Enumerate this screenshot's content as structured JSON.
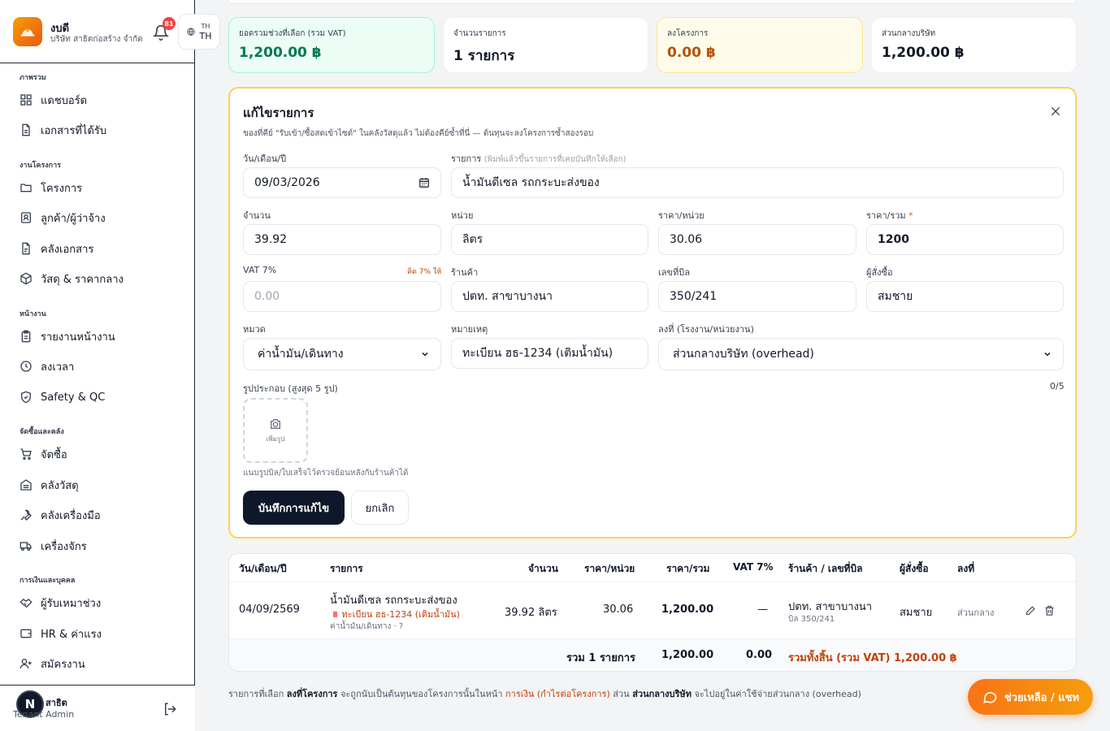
{
  "brand": {
    "title": "งบดี",
    "subtitle": "บริษัท สาธิตก่อสร้าง จำกัด",
    "notification_count": "81"
  },
  "lang": {
    "small": "TH",
    "big": "TH"
  },
  "nav": {
    "sections": [
      {
        "title": "ภาพรวม",
        "items": [
          "แดชบอร์ด",
          "เอกสารที่ได้รับ"
        ]
      },
      {
        "title": "งานโครงการ",
        "items": [
          "โครงการ",
          "ลูกค้า/ผู้ว่าจ้าง",
          "คลังเอกสาร",
          "วัสดุ & ราคากลาง"
        ]
      },
      {
        "title": "หน้างาน",
        "items": [
          "รายงานหน้างาน",
          "ลงเวลา",
          "Safety & QC"
        ]
      },
      {
        "title": "จัดซื้อและคลัง",
        "items": [
          "จัดซื้อ",
          "คลังวัสดุ",
          "คลังเครื่องมือ",
          "เครื่องจักร"
        ]
      },
      {
        "title": "การเงินและบุคคล",
        "items": [
          "ผู้รับเหมาช่วง",
          "HR & ค่าแรง",
          "สมัครงาน"
        ]
      }
    ]
  },
  "user": {
    "avatar_letter": "N",
    "name": "สาธิต",
    "role": "Tenant Admin"
  },
  "stats": [
    {
      "label": "ยอดรวมช่วงที่เลือก (รวม VAT)",
      "value": "1,200.00 ฿"
    },
    {
      "label": "จำนวนรายการ",
      "value": "1 รายการ"
    },
    {
      "label": "ลงโครงการ",
      "value": "0.00 ฿"
    },
    {
      "label": "ส่วนกลางบริษัท",
      "value": "1,200.00 ฿"
    }
  ],
  "form": {
    "title": "แก้ไขรายการ",
    "hint": "ของที่คีย์ \"รับเข้า/ซื้อสดเข้าไซต์\" ในคลังวัสดุแล้ว ไม่ต้องคีย์ซ้ำที่นี่ — ต้นทุนจะลงโครงการซ้ำสองรอบ",
    "date_label": "วัน/เดือน/ปี",
    "date_value": "09/03/2026",
    "item_label": "รายการ",
    "item_hint": "(พิมพ์แล้วขึ้นรายการที่เคยบันทึกให้เลือก)",
    "item_value": "น้ำมันดีเซล รถกระบะส่งของ",
    "qty_label": "จำนวน",
    "qty_value": "39.92",
    "unit_label": "หน่วย",
    "unit_value": "ลิตร",
    "price_label": "ราคา/หน่วย",
    "price_value": "30.06",
    "total_label": "ราคา/รวม",
    "total_req": "*",
    "total_value": "1200",
    "vat_label": "VAT 7%",
    "vat_note": "คิด 7% ให้",
    "vat_placeholder": "0.00",
    "shop_label": "ร้านค้า",
    "shop_value": "ปตท. สาขาบางนา",
    "bill_label": "เลขที่บิล",
    "bill_value": "350/241",
    "buyer_label": "ผู้สั่งซื้อ",
    "buyer_value": "สมชาย",
    "category_label": "หมวด",
    "category_value": "ค่าน้ำมัน/เดินทาง",
    "note_label": "หมายเหตุ",
    "note_value": "ทะเบียน ฮธ-1234 (เติมน้ำมัน)",
    "target_label": "ลงที่ (โรงงาน/หน่วยงาน)",
    "target_value": "ส่วนกลางบริษัท (overhead)",
    "photo_label": "รูปประกอบ (สูงสุด 5 รูป)",
    "photo_count": "0/5",
    "photo_add": "เพิ่มรูป",
    "photo_hint": "แนบรูปบิล/ใบเสร็จไว้ตรวจย้อนหลังกับร้านค้าได้",
    "save": "บันทึกการแก้ไข",
    "cancel": "ยกเลิก"
  },
  "table": {
    "headers": [
      "วัน/เดือน/ปี",
      "รายการ",
      "จำนวน",
      "ราคา/หน่วย",
      "ราคา/รวม",
      "VAT 7%",
      "ร้านค้า / เลขที่บิล",
      "ผู้สั่งซื้อ",
      "ลงที่"
    ],
    "row": {
      "date": "04/09/2569",
      "item": "น้ำมันดีเซล รถกระบะส่งของ",
      "note": "ทะเบียน ฮธ-1234 (เติมน้ำมัน)",
      "category": "ค่าน้ำมัน/เดินทาง · ?",
      "qty": "39.92 ลิตร",
      "price": "30.06",
      "total": "1,200.00",
      "vat": "—",
      "shop": "ปตท. สาขาบางนา",
      "bill": "บิล 350/241",
      "buyer": "สมชาย",
      "target": "ส่วนกลาง"
    },
    "footer": {
      "count": "รวม 1 รายการ",
      "total": "1,200.00",
      "vat": "0.00",
      "grand": "รวมทั้งสิ้น (รวม VAT) 1,200.00 ฿"
    }
  },
  "footnote": {
    "p1": "รายการที่เลือก ",
    "b1": "ลงที่โครงการ",
    "p2": " จะถูกนับเป็นต้นทุนของโครงการนั้นในหน้า ",
    "link": "การเงิน (กำไรต่อโครงการ)",
    "p3": " ส่วน ",
    "b2": "ส่วนกลางบริษัท",
    "p4": " จะไปอยู่ในค่าใช้จ่ายส่วนกลาง (overhead)"
  },
  "help": {
    "label": "ช่วยเหลือ / แชท"
  },
  "colors": {
    "accent": "#f97316",
    "green_card": "#ecfdf5",
    "green_text": "#047857",
    "yellow_card": "#fffbeb",
    "yellow_text": "#b45309",
    "dark": "#0f172a"
  }
}
